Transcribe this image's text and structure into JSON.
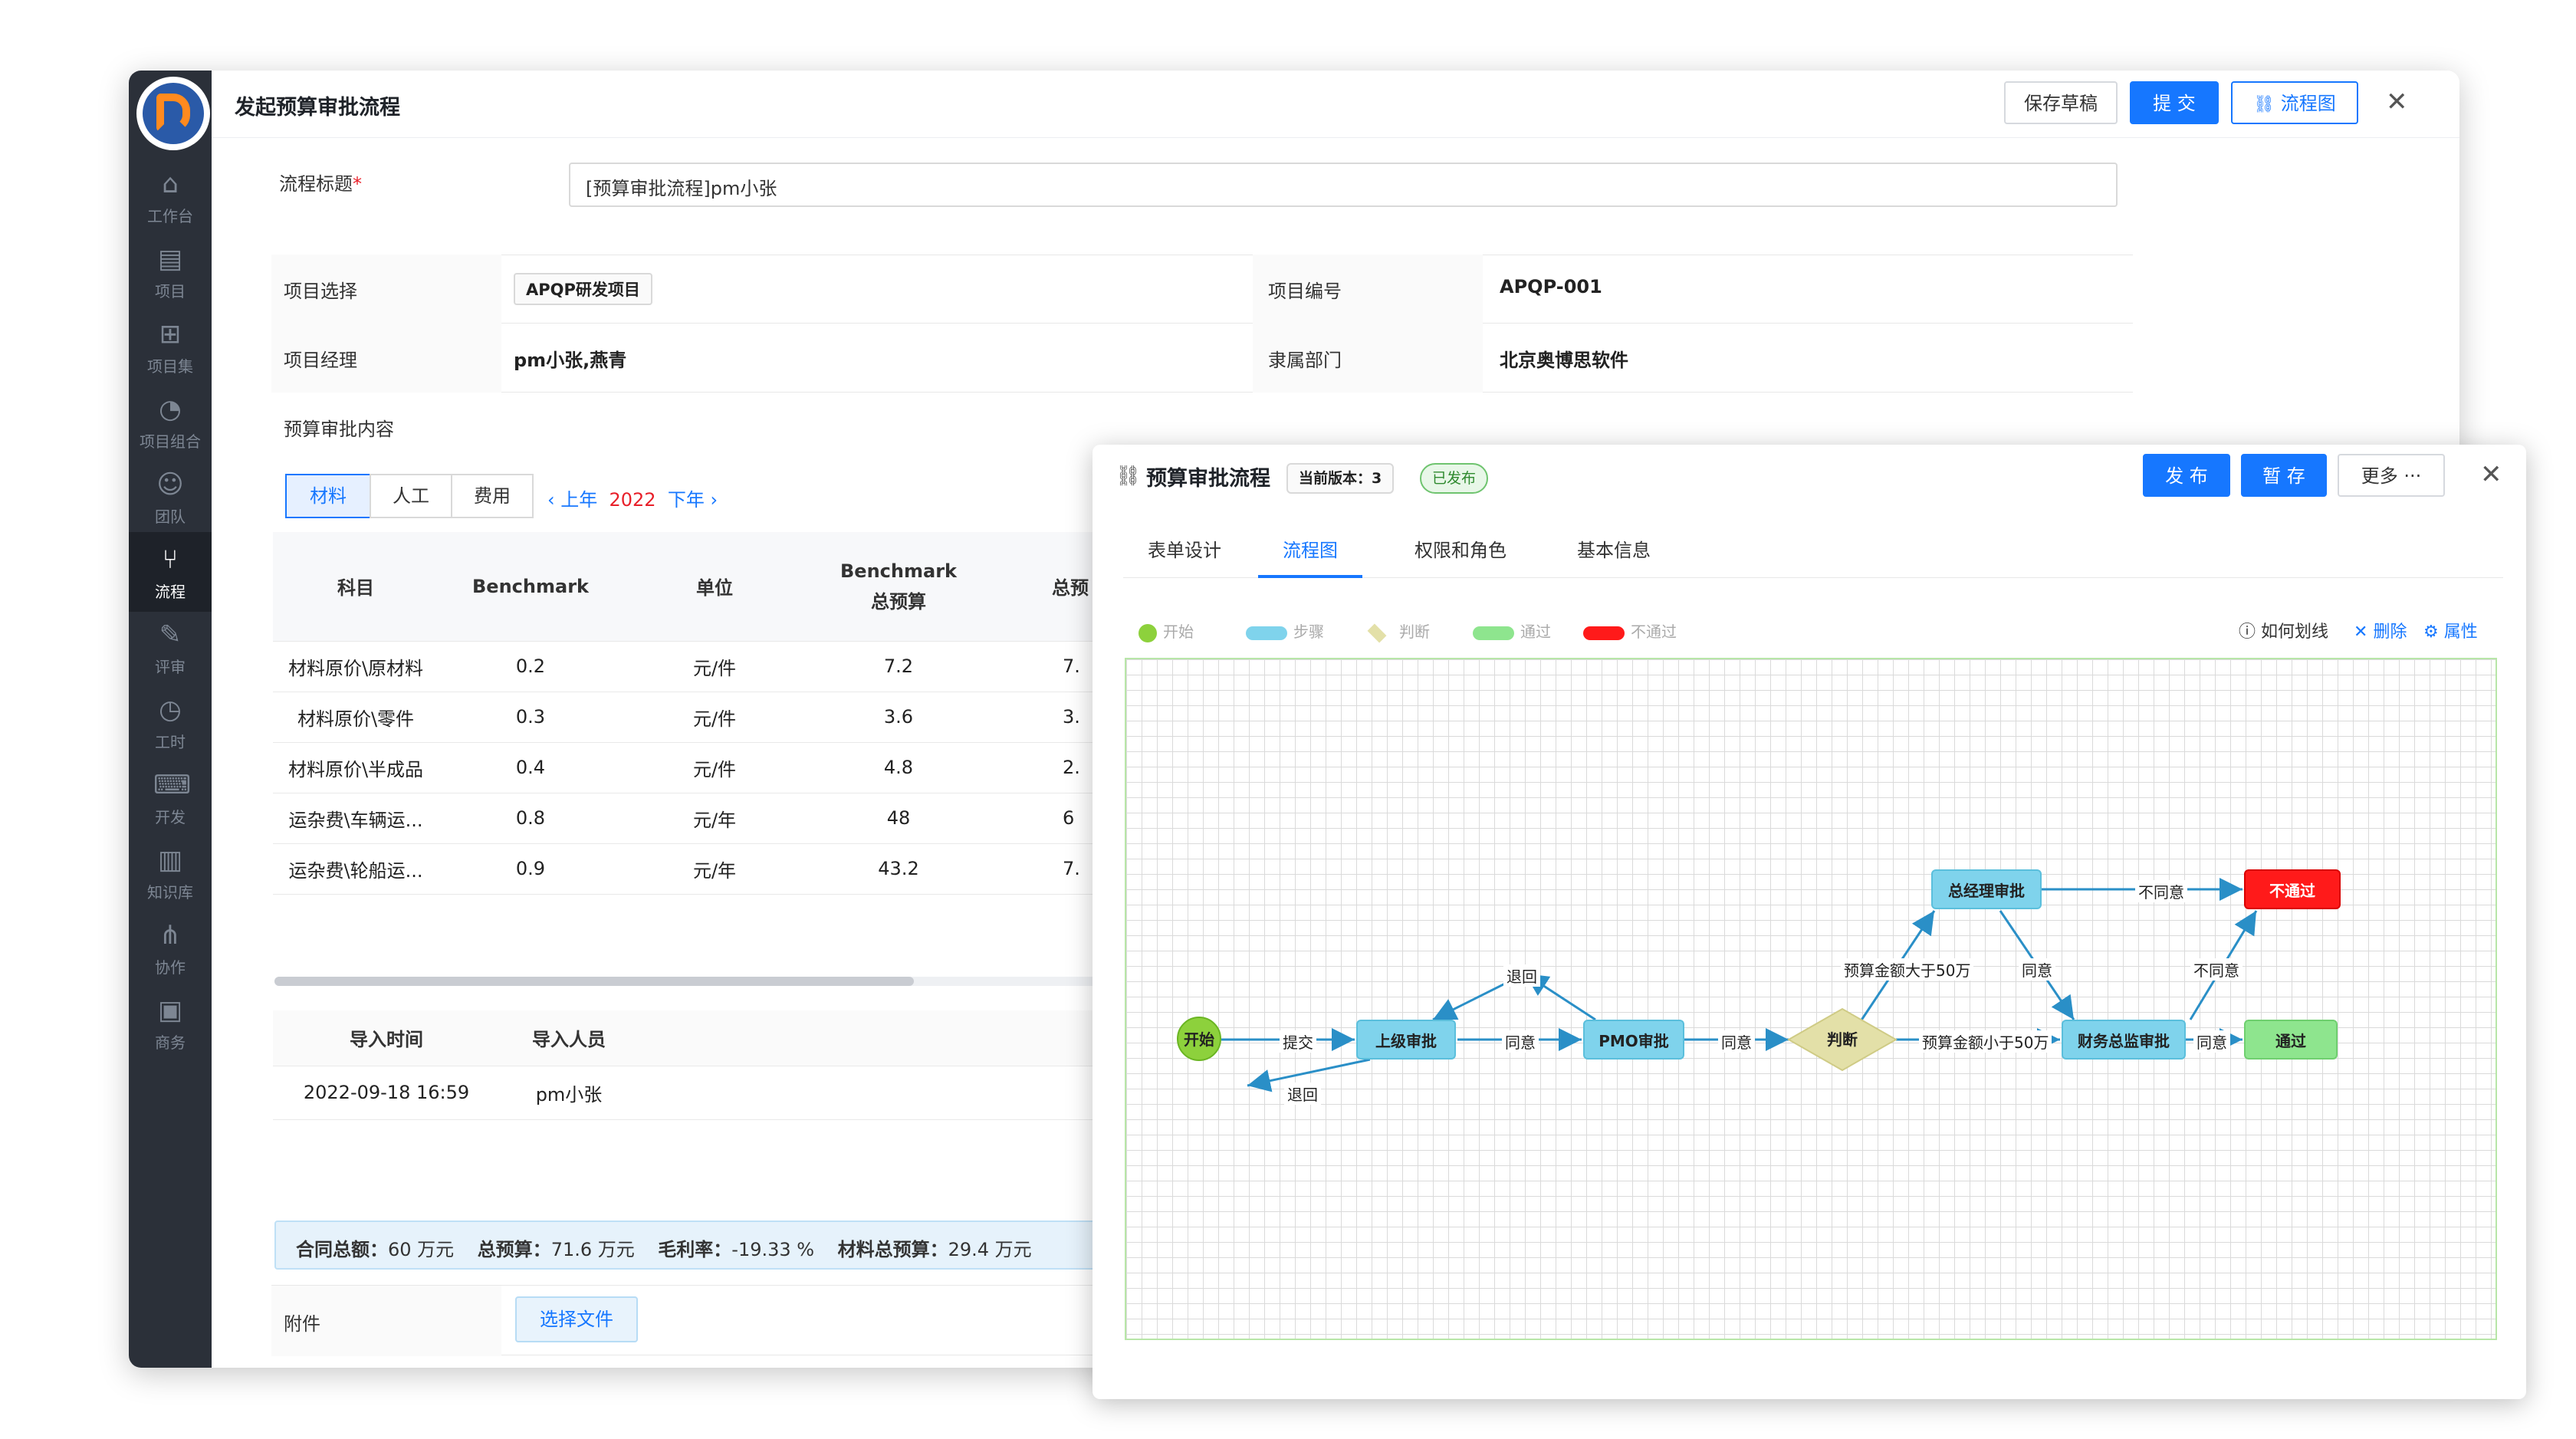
{
  "main": {
    "title": "发起预算审批流程",
    "save_draft": "保存草稿",
    "submit": "提 交",
    "flowchart_btn": "流程图",
    "nav": [
      {
        "label": "工作台",
        "icon": "home-icon"
      },
      {
        "label": "项目",
        "icon": "project-icon"
      },
      {
        "label": "项目集",
        "icon": "project-set-icon"
      },
      {
        "label": "项目组合",
        "icon": "portfolio-icon"
      },
      {
        "label": "团队",
        "icon": "team-icon"
      },
      {
        "label": "流程",
        "icon": "flow-icon"
      },
      {
        "label": "评审",
        "icon": "review-icon"
      },
      {
        "label": "工时",
        "icon": "clock-icon"
      },
      {
        "label": "开发",
        "icon": "terminal-icon"
      },
      {
        "label": "知识库",
        "icon": "book-icon"
      },
      {
        "label": "协作",
        "icon": "share-icon"
      },
      {
        "label": "商务",
        "icon": "business-icon"
      }
    ],
    "form": {
      "flow_title_label": "流程标题",
      "required_mark": "*",
      "flow_title_value": "[预算审批流程]pm小张",
      "project_select_label": "项目选择",
      "project_select_value": "APQP研发项目",
      "project_no_label": "项目编号",
      "project_no_value": "APQP-001",
      "manager_label": "项目经理",
      "manager_value": "pm小张,燕青",
      "dept_label": "隶属部门",
      "dept_value": "北京奥博思软件",
      "budget_content_label": "预算审批内容",
      "attachment_label": "附件",
      "choose_file": "选择文件"
    },
    "segment_tabs": [
      "材料",
      "人工",
      "费用"
    ],
    "year_nav": {
      "prev": "上年",
      "year": "2022",
      "next": "下年"
    },
    "budget_table": {
      "headers": [
        "科目",
        "Benchmark",
        "单位",
        "Benchmark\n总预算",
        "总预"
      ],
      "rows": [
        [
          "材料原价\\原材料",
          "0.2",
          "元/件",
          "7.2",
          "7."
        ],
        [
          "材料原价\\零件",
          "0.3",
          "元/件",
          "3.6",
          "3."
        ],
        [
          "材料原价\\半成品",
          "0.4",
          "元/件",
          "4.8",
          "2."
        ],
        [
          "运杂费\\车辆运...",
          "0.8",
          "元/年",
          "48",
          "6"
        ],
        [
          "运杂费\\轮船运...",
          "0.9",
          "元/年",
          "43.2",
          "7."
        ]
      ]
    },
    "import_table": {
      "headers": [
        "导入时间",
        "导入人员"
      ],
      "rows": [
        [
          "2022-09-18 16:59",
          "pm小张"
        ]
      ]
    },
    "summary": {
      "contract_label": "合同总额：",
      "contract_value": "60 万元",
      "budget_label": "总预算：",
      "budget_value": "71.6 万元",
      "margin_label": "毛利率：",
      "margin_value": "-19.33 %",
      "material_label": "材料总预算：",
      "material_value": "29.4 万元"
    }
  },
  "flow": {
    "title": "预算审批流程",
    "version": "当前版本：3",
    "status": "已发布",
    "publish": "发 布",
    "save_temp": "暂 存",
    "more": "更多 ···",
    "tabs": [
      "表单设计",
      "流程图",
      "权限和角色",
      "基本信息"
    ],
    "legend": [
      {
        "label": "开始",
        "color": "#8dd13c",
        "shape": "circle"
      },
      {
        "label": "步骤",
        "color": "#7fd3ec",
        "shape": "pill"
      },
      {
        "label": "判断",
        "color": "#e3e0a8",
        "shape": "diamond"
      },
      {
        "label": "通过",
        "color": "#8ee58e",
        "shape": "pill"
      },
      {
        "label": "不通过",
        "color": "#ff1a1a",
        "shape": "pill"
      }
    ],
    "tools": {
      "help": "如何划线",
      "delete": "删除",
      "props": "属性"
    },
    "nodes": {
      "start": "开始",
      "superior": "上级审批",
      "pmo": "PMO审批",
      "judge": "判断",
      "gm": "总经理审批",
      "finance": "财务总监审批",
      "pass": "通过",
      "fail": "不通过"
    },
    "edges": {
      "submit": "提交",
      "return1": "退回",
      "agree1": "同意",
      "return2": "退回",
      "agree2": "同意",
      "gt50": "预算金额大于50万",
      "lt50": "预算金额小于50万",
      "gm_reject": "不同意",
      "gm_agree": "同意",
      "fin_reject": "不同意",
      "fin_agree": "同意"
    }
  }
}
